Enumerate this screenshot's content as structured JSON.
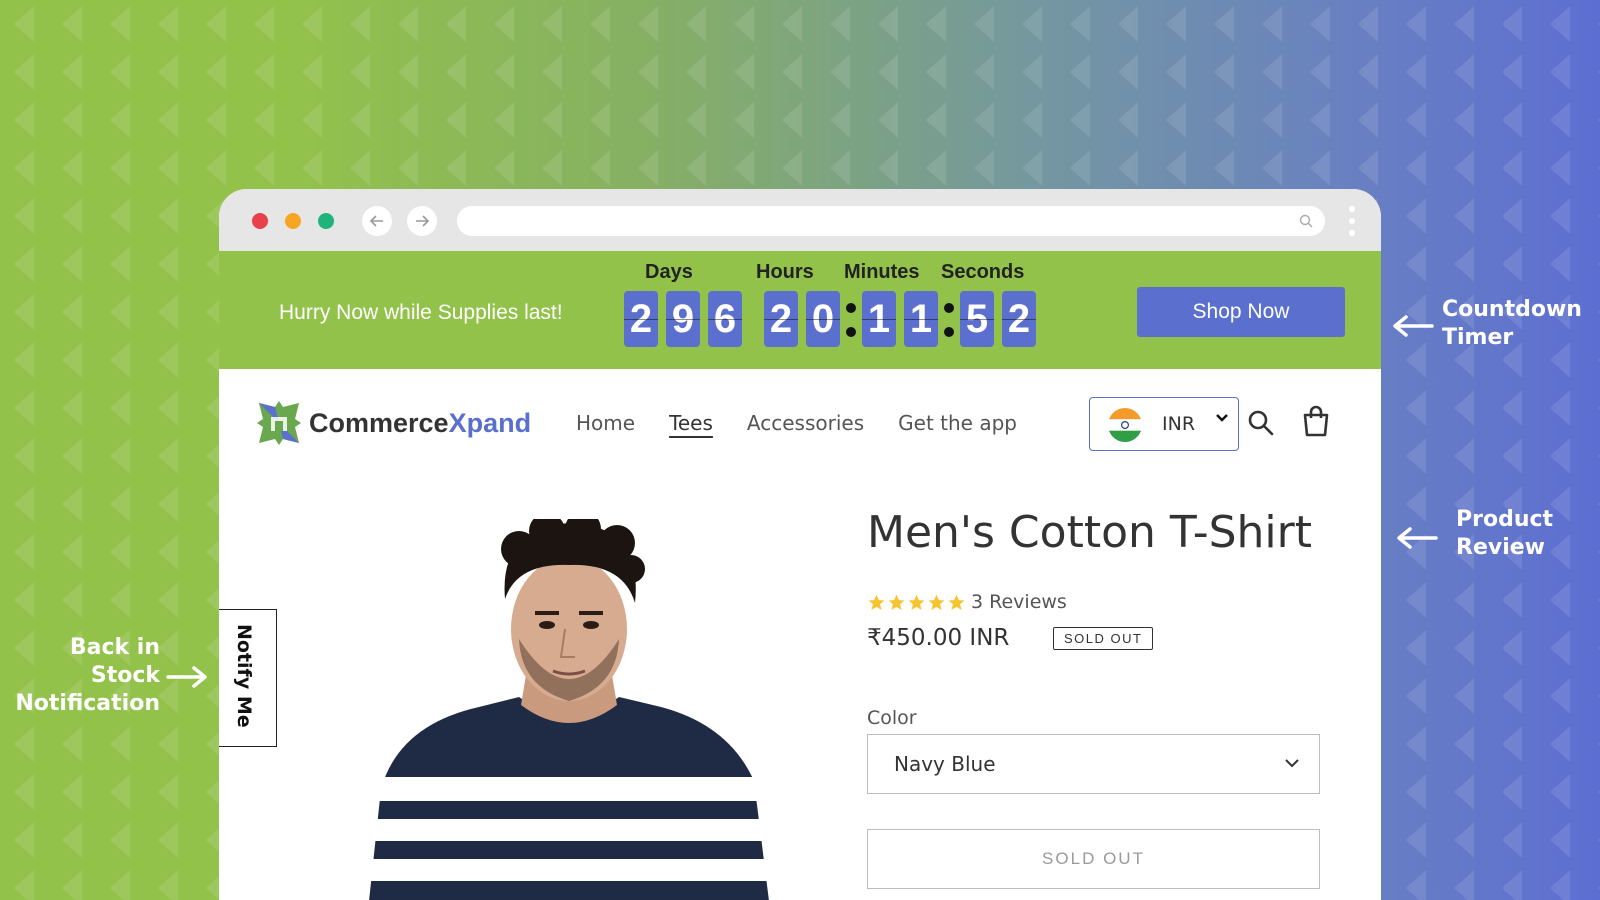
{
  "annotations": {
    "countdown": [
      "Countdown",
      "Timer"
    ],
    "review": [
      "Product",
      "Review"
    ],
    "back_in_stock": [
      "Back in",
      "Stock",
      "Notification"
    ]
  },
  "browser": {
    "colors": {
      "close": "#e8414c",
      "minimize": "#f6a623",
      "maximize": "#1fb47a"
    },
    "icons": [
      "back-arrow-icon",
      "forward-arrow-icon",
      "search-icon",
      "kebab-menu-icon"
    ]
  },
  "countdown_bar": {
    "message": "Hurry Now while Supplies last!",
    "labels": {
      "days": "Days",
      "hours": "Hours",
      "minutes": "Minutes",
      "seconds": "Seconds"
    },
    "days": [
      "2",
      "9",
      "6"
    ],
    "hours": [
      "2",
      "0"
    ],
    "minutes": [
      "1",
      "1"
    ],
    "seconds": [
      "5",
      "2"
    ],
    "button": "Shop Now",
    "bar_color": "#93c24b",
    "accent": "#5b6fcf"
  },
  "store": {
    "logo_main": "Commerce",
    "logo_accent": "Xpand",
    "nav": [
      "Home",
      "Tees",
      "Accessories",
      "Get the app"
    ],
    "active_nav": "Tees",
    "currency": "INR",
    "icons": [
      "india-flag-icon",
      "chevron-down-icon",
      "search-icon",
      "shopping-bag-icon"
    ]
  },
  "notify": {
    "label": "Notify Me"
  },
  "product": {
    "title": "Men's Cotton T-Shirt",
    "rating": 5,
    "reviews": "3 Reviews",
    "price": "₹450.00 INR",
    "badge": "SOLD OUT",
    "color_label": "Color",
    "color_value": "Navy Blue",
    "button": "SOLD OUT"
  }
}
